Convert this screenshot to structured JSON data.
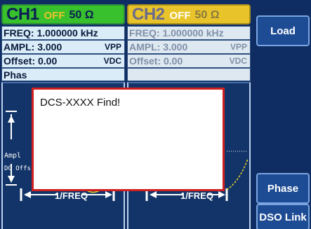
{
  "ch1": {
    "name": "CH1",
    "state": "OFF",
    "impedance": "50 Ω",
    "freq": "FREQ: 1.000000 kHz",
    "ampl_label": "AMPL: 3.000",
    "ampl_unit": "VPP",
    "offset_label": "Offset:  0.00",
    "offset_unit": "VDC",
    "phase_label": "Phas",
    "wave_ampl_label": "Ampl",
    "wave_dc_label": "DC Offs",
    "freq_marker": "1/FREQ"
  },
  "ch2": {
    "name": "CH2",
    "state": "OFF",
    "impedance": "50 Ω",
    "freq": "FREQ: 1.000000 kHz",
    "ampl_label": "AMPL: 3.000",
    "ampl_unit": "VPP",
    "offset_label": "Offset:  0.00",
    "offset_unit": "VDC",
    "freq_marker": "1/FREQ"
  },
  "softkeys": {
    "load": "Load",
    "phase": "Phase",
    "dso_link": "DSO Link"
  },
  "dialog": {
    "message": "DCS-XXXX Find!"
  },
  "colors": {
    "background": "#0f2d63",
    "ch1_header": "#38c02d",
    "ch2_header": "#e8c42a",
    "dialog_border": "#d11f1f",
    "softkey_bg": "#1d4b94"
  }
}
